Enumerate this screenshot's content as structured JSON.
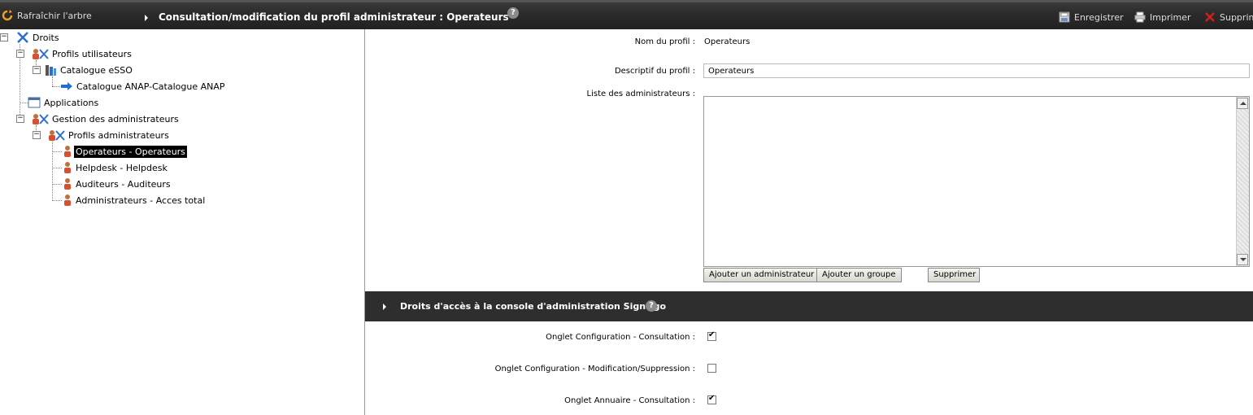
{
  "toolbar": {
    "refresh_label": "Rafraîchir l'arbre",
    "title": "Consultation/modification du profil administrateur : Operateurs",
    "help": "?",
    "save_label": "Enregistrer",
    "print_label": "Imprimer",
    "delete_label": "Supprimer"
  },
  "tree": {
    "root": "Droits",
    "profiles_users": "Profils utilisateurs",
    "catalog": "Catalogue eSSO",
    "catalog_item": "Catalogue ANAP-Catalogue ANAP",
    "applications": "Applications",
    "admin_mgmt": "Gestion des administrateurs",
    "admin_profiles": "Profils administrateurs",
    "items": [
      "Operateurs - Operateurs",
      "Helpdesk - Helpdesk",
      "Auditeurs - Auditeurs",
      "Administrateurs - Acces total"
    ],
    "pm_minus": "−"
  },
  "form": {
    "name_label": "Nom du profil :",
    "name_value": "Operateurs",
    "desc_label": "Descriptif du profil :",
    "desc_value": "Operateurs",
    "admins_label": "Liste des administrateurs :",
    "add_admin": "Ajouter un administrateur",
    "add_group": "Ajouter un groupe",
    "remove": "Supprimer"
  },
  "rights": {
    "title": "Droits d'accès à la console d'administration Sign&go",
    "help": "?",
    "items": [
      {
        "label": "Onglet Configuration - Consultation :",
        "checked": true
      },
      {
        "label": "Onglet Configuration - Modification/Suppression :",
        "checked": false
      },
      {
        "label": "Onglet Annuaire - Consultation :",
        "checked": true
      }
    ]
  }
}
